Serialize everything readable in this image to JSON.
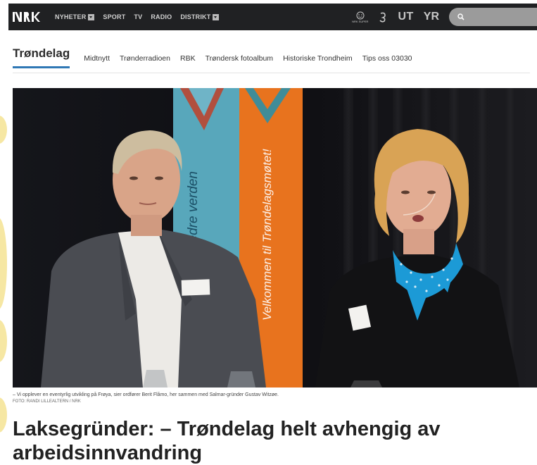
{
  "topbar": {
    "logo_text": "NRK",
    "nav": [
      {
        "label": "NYHETER",
        "dropdown": true
      },
      {
        "label": "SPORT",
        "dropdown": false
      },
      {
        "label": "TV",
        "dropdown": false
      },
      {
        "label": "RADIO",
        "dropdown": false
      },
      {
        "label": "DISTRIKT",
        "dropdown": true
      }
    ],
    "tools": {
      "super_label": "NRK SUPER",
      "ut_label": "UT",
      "yr_label": "YR"
    },
    "search_placeholder": ""
  },
  "subnav": {
    "region": "Trøndelag",
    "links": [
      "Midtnytt",
      "Trønderradioen",
      "RBK",
      "Trøndersk fotoalbum",
      "Historiske Trondheim",
      "Tips oss 03030"
    ]
  },
  "photo": {
    "banner_left_text": "bedre verden",
    "banner_right_text": "Velkommen til Trøndelagsmøtet!"
  },
  "article": {
    "caption": "– Vi opplever en eventyrlig utvikling på Frøya, sier ordfører Berit Flåmo, her sammen med Salmar-gründer Gustav Witzøe.",
    "credit": "FOTO: RANDI LILLEALTERN / NRK",
    "headline": "Laksegründer: – Trøndelag helt avhengig av arbeidsinnvandring"
  },
  "colors": {
    "topbar_bg": "#202123",
    "accent_underline": "#2f78b5",
    "banner_orange": "#e8731e",
    "banner_teal": "#2d8fa5",
    "scarf_blue": "#1c9ad6"
  }
}
